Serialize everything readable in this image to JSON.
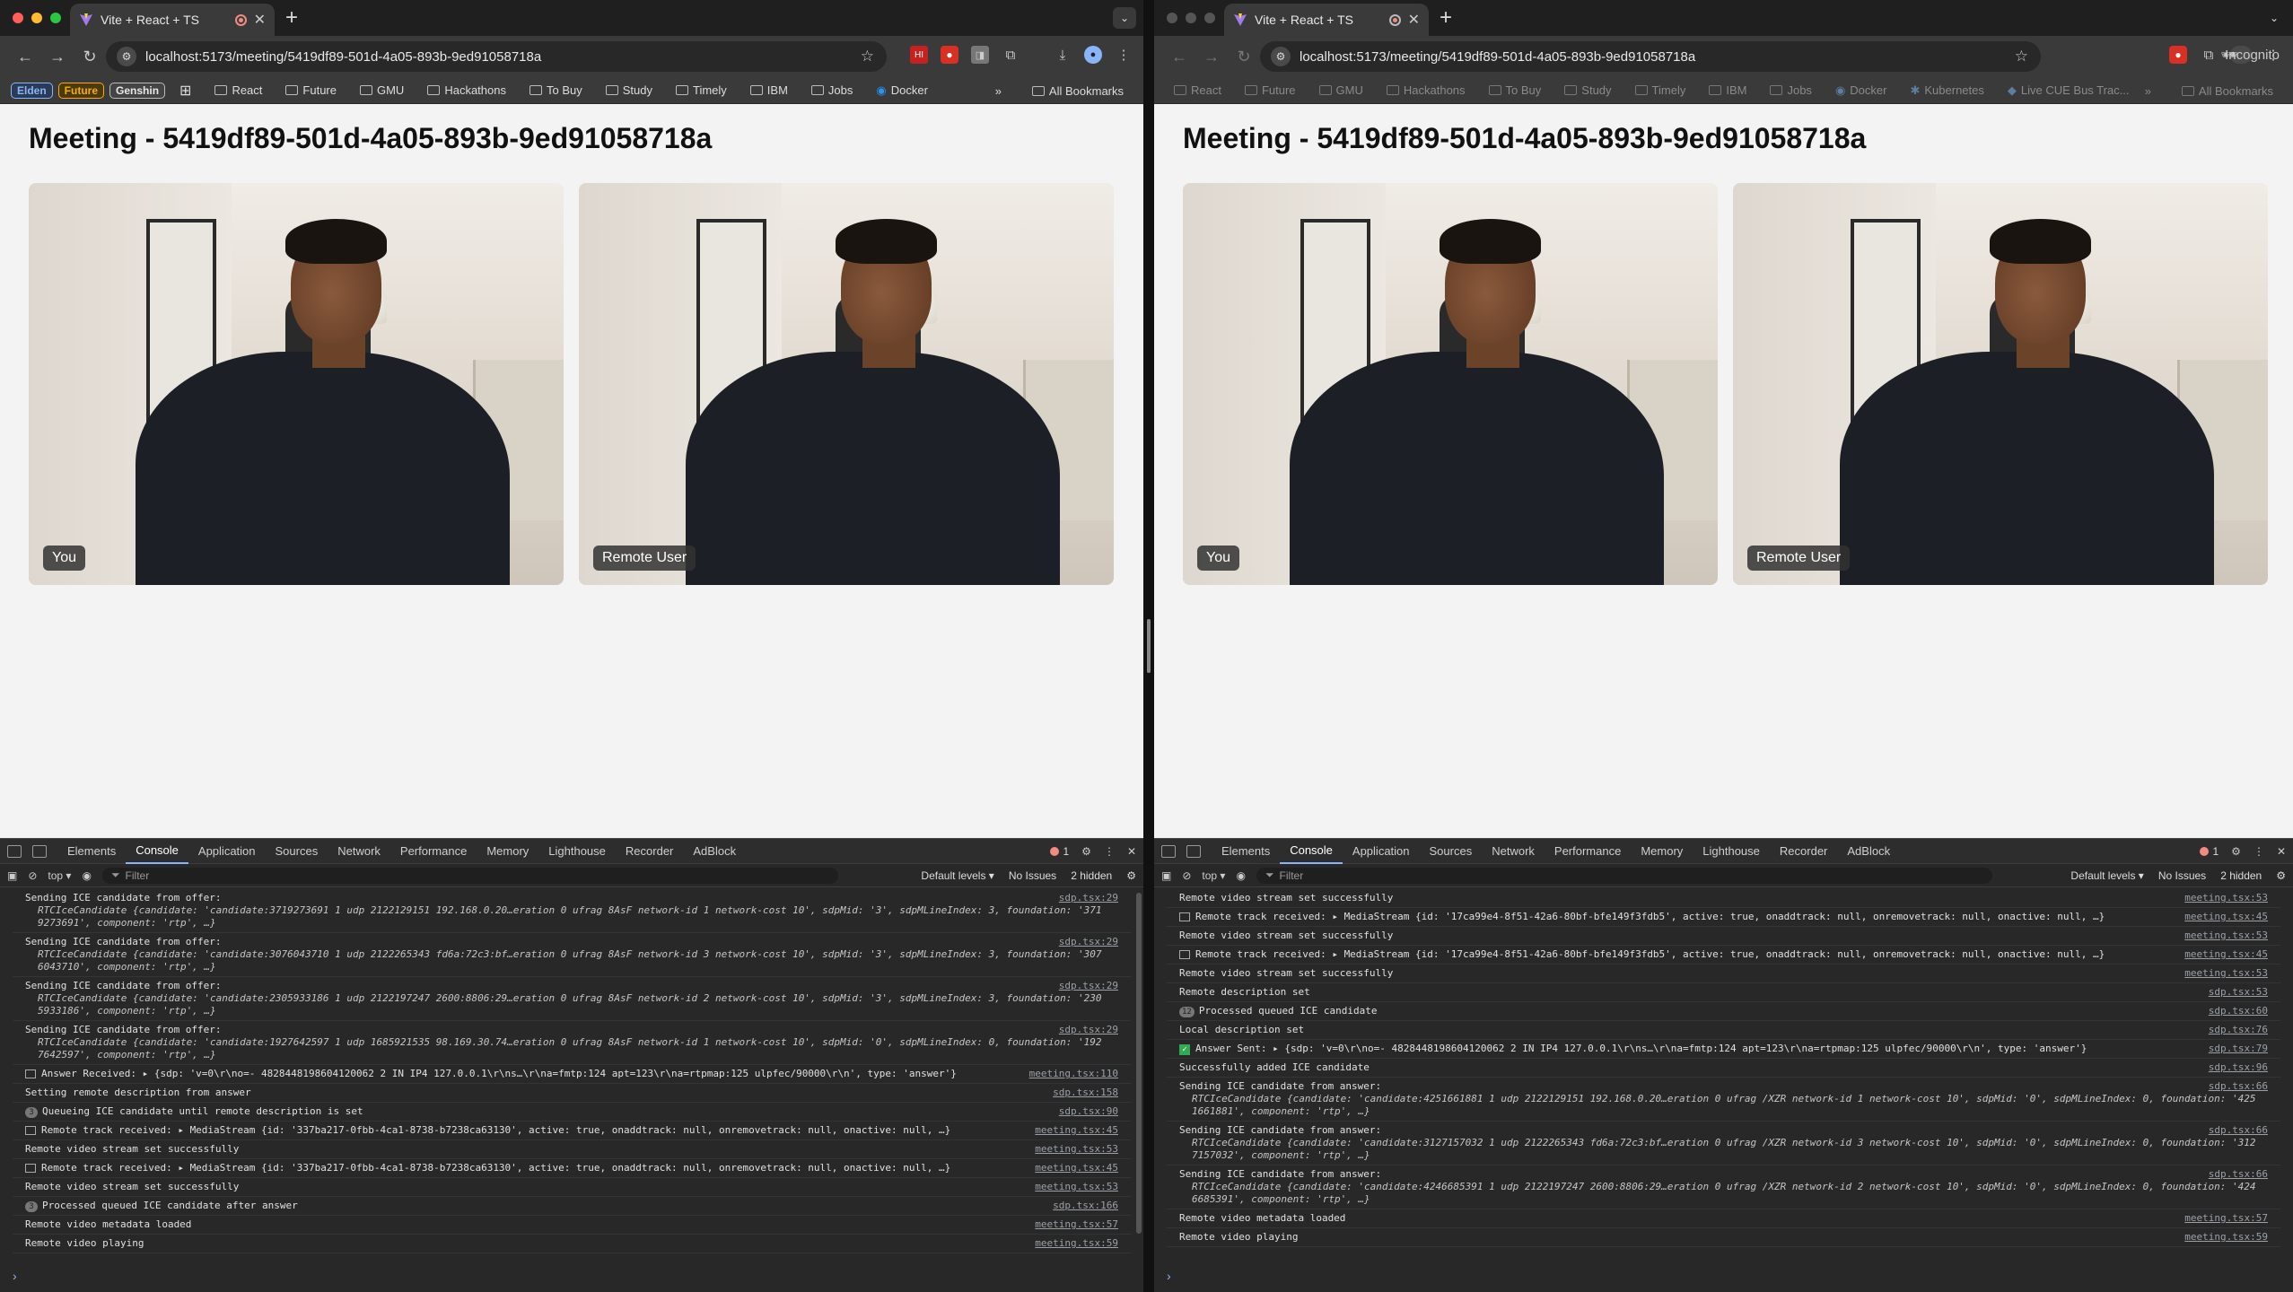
{
  "left": {
    "tab_title": "Vite + React + TS",
    "url": "localhost:5173/meeting/5419df89-501d-4a05-893b-9ed91058718a",
    "chips": [
      {
        "label": "Elden",
        "color": "#8ab4f8"
      },
      {
        "label": "Future",
        "color": "#f9ab00"
      },
      {
        "label": "Genshin",
        "color": "#e8e8e8"
      }
    ],
    "bookmarks": [
      "React",
      "Future",
      "GMU",
      "Hackathons",
      "To Buy",
      "Study",
      "Timely",
      "IBM",
      "Jobs",
      "Docker"
    ],
    "all_bookmarks": "All Bookmarks",
    "heading": "Meeting - 5419df89-501d-4a05-893b-9ed91058718a",
    "video_local_label": "You",
    "video_remote_label": "Remote User",
    "devtools": {
      "tabs": [
        "Elements",
        "Console",
        "Application",
        "Sources",
        "Network",
        "Performance",
        "Memory",
        "Lighthouse",
        "Recorder",
        "AdBlock"
      ],
      "error_count": "1",
      "context": "top",
      "filter_placeholder": "Filter",
      "levels": "Default levels",
      "issues": "No Issues",
      "hidden": "2 hidden",
      "logs": [
        {
          "text": "Sending ICE candidate from offer:",
          "detail": "RTCIceCandidate {candidate: 'candidate:3719273691 1 udp 2122129151 192.168.0.20…eration 0 ufrag 8AsF network-id 1 network-cost 10', sdpMid: '3', sdpMLineIndex: 3, foundation: '371",
          "detail2": "9273691', component: 'rtp', …}",
          "src": "sdp.tsx:29"
        },
        {
          "text": "Sending ICE candidate from offer:",
          "detail": "RTCIceCandidate {candidate: 'candidate:3076043710 1 udp 2122265343 fd6a:72c3:bf…eration 0 ufrag 8AsF network-id 3 network-cost 10', sdpMid: '3', sdpMLineIndex: 3, foundation: '307",
          "detail2": "6043710', component: 'rtp', …}",
          "src": "sdp.tsx:29"
        },
        {
          "text": "Sending ICE candidate from offer:",
          "detail": "RTCIceCandidate {candidate: 'candidate:2305933186 1 udp 2122197247 2600:8806:29…eration 0 ufrag 8AsF network-id 2 network-cost 10', sdpMid: '3', sdpMLineIndex: 3, foundation: '230",
          "detail2": "5933186', component: 'rtp', …}",
          "src": "sdp.tsx:29"
        },
        {
          "text": "Sending ICE candidate from offer:",
          "detail": "RTCIceCandidate {candidate: 'candidate:1927642597 1 udp 1685921535 98.169.30.74…eration 0 ufrag 8AsF network-id 1 network-cost 10', sdpMid: '0', sdpMLineIndex: 0, foundation: '192",
          "detail2": "7642597', component: 'rtp', …}",
          "src": "sdp.tsx:29"
        },
        {
          "text": "Answer Received:  ▸ {sdp: 'v=0\\r\\no=- 4828448198604120062 2 IN IP4 127.0.0.1\\r\\ns…\\r\\na=fmtp:124 apt=123\\r\\na=rtpmap:125 ulpfec/90000\\r\\n', type: 'answer'}",
          "src": "meeting.tsx:110"
        },
        {
          "text": "Setting remote description from answer",
          "src": "sdp.tsx:158"
        },
        {
          "count": "3",
          "text": "Queueing ICE candidate until remote description is set",
          "src": "sdp.tsx:90"
        },
        {
          "text": "Remote track received:  ▸ MediaStream {id: '337ba217-0fbb-4ca1-8738-b7238ca63130', active: true, onaddtrack: null, onremovetrack: null, onactive: null, …}",
          "src": "meeting.tsx:45"
        },
        {
          "text": "Remote video stream set successfully",
          "src": "meeting.tsx:53"
        },
        {
          "text": "Remote track received:  ▸ MediaStream {id: '337ba217-0fbb-4ca1-8738-b7238ca63130', active: true, onaddtrack: null, onremovetrack: null, onactive: null, …}",
          "src": "meeting.tsx:45"
        },
        {
          "text": "Remote video stream set successfully",
          "src": "meeting.tsx:53"
        },
        {
          "count": "3",
          "text": "Processed queued ICE candidate after answer",
          "src": "sdp.tsx:166"
        },
        {
          "text": "Remote video metadata loaded",
          "src": "meeting.tsx:57"
        },
        {
          "text": "Remote video playing",
          "src": "meeting.tsx:59"
        }
      ]
    }
  },
  "right": {
    "tab_title": "Vite + React + TS",
    "url": "localhost:5173/meeting/5419df89-501d-4a05-893b-9ed91058718a",
    "incognito": "Incognito",
    "bookmarks": [
      "React",
      "Future",
      "GMU",
      "Hackathons",
      "To Buy",
      "Study",
      "Timely",
      "IBM",
      "Jobs",
      "Docker",
      "Kubernetes",
      "Live CUE Bus Trac..."
    ],
    "all_bookmarks": "All Bookmarks",
    "heading": "Meeting - 5419df89-501d-4a05-893b-9ed91058718a",
    "video_local_label": "You",
    "video_remote_label": "Remote User",
    "devtools": {
      "tabs": [
        "Elements",
        "Console",
        "Application",
        "Sources",
        "Network",
        "Performance",
        "Memory",
        "Lighthouse",
        "Recorder",
        "AdBlock"
      ],
      "error_count": "1",
      "context": "top",
      "filter_placeholder": "Filter",
      "levels": "Default levels",
      "issues": "No Issues",
      "hidden": "2 hidden",
      "logs": [
        {
          "text": "Remote video stream set successfully",
          "src": "meeting.tsx:53"
        },
        {
          "text": "Remote track received:  ▸ MediaStream {id: '17ca99e4-8f51-42a6-80bf-bfe149f3fdb5', active: true, onaddtrack: null, onremovetrack: null, onactive: null, …}",
          "src": "meeting.tsx:45"
        },
        {
          "text": "Remote video stream set successfully",
          "src": "meeting.tsx:53"
        },
        {
          "text": "Remote track received:  ▸ MediaStream {id: '17ca99e4-8f51-42a6-80bf-bfe149f3fdb5', active: true, onaddtrack: null, onremovetrack: null, onactive: null, …}",
          "src": "meeting.tsx:45"
        },
        {
          "text": "Remote video stream set successfully",
          "src": "meeting.tsx:53"
        },
        {
          "text": "Remote description set",
          "src": "sdp.tsx:53"
        },
        {
          "count": "12",
          "text": "Processed queued ICE candidate",
          "src": "sdp.tsx:60"
        },
        {
          "text": "Local description set",
          "src": "sdp.tsx:76"
        },
        {
          "check": true,
          "text": "Answer Sent:  ▸ {sdp: 'v=0\\r\\no=- 4828448198604120062 2 IN IP4 127.0.0.1\\r\\ns…\\r\\na=fmtp:124 apt=123\\r\\na=rtpmap:125 ulpfec/90000\\r\\n', type: 'answer'}",
          "src": "sdp.tsx:79"
        },
        {
          "text": "Successfully added ICE candidate",
          "src": "sdp.tsx:96"
        },
        {
          "text": "Sending ICE candidate from answer:",
          "detail": "RTCIceCandidate {candidate: 'candidate:4251661881 1 udp 2122129151 192.168.0.20…eration 0 ufrag /XZR network-id 1 network-cost 10', sdpMid: '0', sdpMLineIndex: 0, foundation: '425",
          "detail2": "1661881', component: 'rtp', …}",
          "src": "sdp.tsx:66"
        },
        {
          "text": "Sending ICE candidate from answer:",
          "detail": "RTCIceCandidate {candidate: 'candidate:3127157032 1 udp 2122265343 fd6a:72c3:bf…eration 0 ufrag /XZR network-id 3 network-cost 10', sdpMid: '0', sdpMLineIndex: 0, foundation: '312",
          "detail2": "7157032', component: 'rtp', …}",
          "src": "sdp.tsx:66"
        },
        {
          "text": "Sending ICE candidate from answer:",
          "detail": "RTCIceCandidate {candidate: 'candidate:4246685391 1 udp 2122197247 2600:8806:29…eration 0 ufrag /XZR network-id 2 network-cost 10', sdpMid: '0', sdpMLineIndex: 0, foundation: '424",
          "detail2": "6685391', component: 'rtp', …}",
          "src": "sdp.tsx:66"
        },
        {
          "text": "Remote video metadata loaded",
          "src": "meeting.tsx:57"
        },
        {
          "text": "Remote video playing",
          "src": "meeting.tsx:59"
        }
      ]
    }
  },
  "colors": {
    "traffic_red": "#ff5f57",
    "traffic_yellow": "#febc2e",
    "traffic_green": "#28c840",
    "link_blue": "#8ab4f8"
  }
}
